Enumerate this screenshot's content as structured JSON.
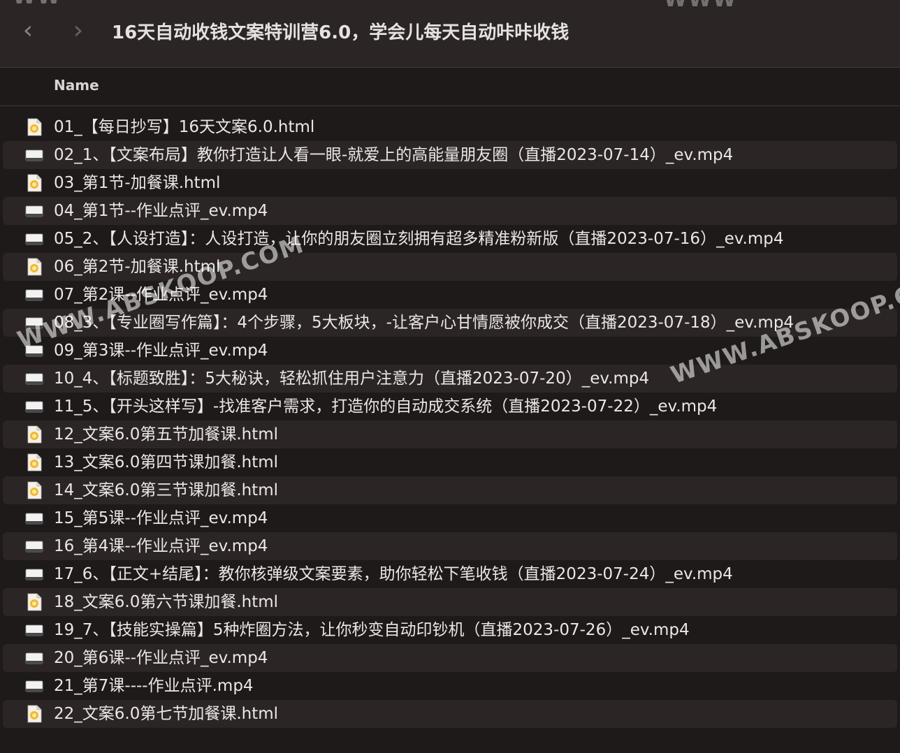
{
  "window": {
    "title": "16天自动收钱文案特训营6.0，学会儿每天自动咔咔收钱",
    "back_icon": "‹",
    "forward_icon": "›"
  },
  "columns": {
    "name": "Name"
  },
  "files": [
    {
      "name": "01_【每日抄写】16天文案6.0.html",
      "type": "html-icon"
    },
    {
      "name": "02_1、【文案布局】教你打造让人看一眼-就爱上的高能量朋友圈（直播2023-07-14）_ev.mp4",
      "type": "video-icon"
    },
    {
      "name": "03_第1节-加餐课.html",
      "type": "html-icon"
    },
    {
      "name": "04_第1节--作业点评_ev.mp4",
      "type": "video-icon"
    },
    {
      "name": "05_2、【人设打造】：人设打造，让你的朋友圈立刻拥有超多精准粉新版（直播2023-07-16）_ev.mp4",
      "type": "video-icon"
    },
    {
      "name": "06_第2节-加餐课.html",
      "type": "html-icon"
    },
    {
      "name": "07_第2课--作业点评_ev.mp4",
      "type": "video-icon"
    },
    {
      "name": "08_3、【专业圈写作篇】：4个步骤，5大板块，-让客户心甘情愿被你成交（直播2023-07-18）_ev.mp4",
      "type": "video-icon"
    },
    {
      "name": "09_第3课--作业点评_ev.mp4",
      "type": "video-icon"
    },
    {
      "name": "10_4、【标题致胜】：5大秘诀，轻松抓住用户注意力（直播2023-07-20）_ev.mp4",
      "type": "video-icon"
    },
    {
      "name": "11_5、【开头这样写】-找准客户需求，打造你的自动成交系统（直播2023-07-22）_ev.mp4",
      "type": "video-icon"
    },
    {
      "name": "12_文案6.0第五节加餐课.html",
      "type": "html-icon"
    },
    {
      "name": "13_文案6.0第四节课加餐.html",
      "type": "html-icon"
    },
    {
      "name": "14_文案6.0第三节课加餐.html",
      "type": "html-icon"
    },
    {
      "name": "15_第5课--作业点评_ev.mp4",
      "type": "video-icon"
    },
    {
      "name": "16_第4课--作业点评_ev.mp4",
      "type": "video-icon"
    },
    {
      "name": "17_6、【正文+结尾】：教你核弹级文案要素，助你轻松下笔收钱（直播2023-07-24）_ev.mp4",
      "type": "video-icon"
    },
    {
      "name": "18_文案6.0第六节课加餐.html",
      "type": "html-icon"
    },
    {
      "name": "19_7、【技能实操篇】5种炸圈方法，让你秒变自动印钞机（直播2023-07-26）_ev.mp4",
      "type": "video-icon"
    },
    {
      "name": "20_第6课--作业点评_ev.mp4",
      "type": "video-icon"
    },
    {
      "name": "21_第7课----作业点评.mp4",
      "type": "video-icon"
    },
    {
      "name": "22_文案6.0第七节加餐课.html",
      "type": "html-icon"
    }
  ],
  "watermarks": [
    "WWW.ABSKOOP.COM",
    "WWW.ABSKOOP.C",
    "WW",
    "WWW"
  ],
  "colors": {
    "background": "#1f1a1a",
    "row_alt": "#2b2625",
    "text": "#ebe7e6",
    "html_icon_accent": "#f2b92b"
  }
}
